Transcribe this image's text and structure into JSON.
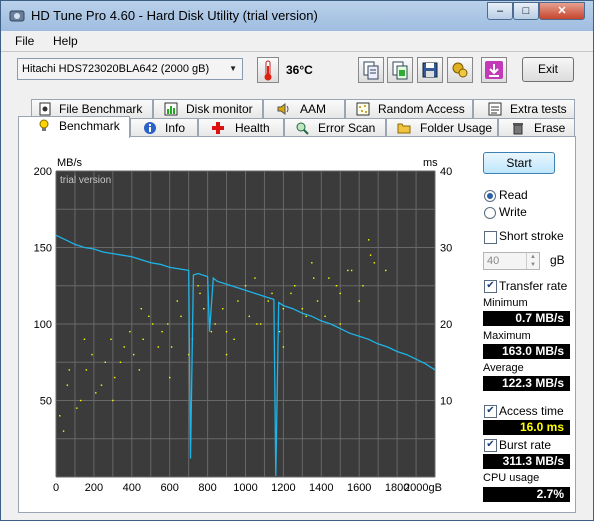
{
  "window": {
    "title": "HD Tune Pro 4.60 - Hard Disk Utility (trial version)",
    "minimize": "–",
    "maximize": "□",
    "close": "✕"
  },
  "menu": {
    "file": "File",
    "help": "Help"
  },
  "toolbar": {
    "drive": "Hitachi HDS723020BLA642 (2000 gB)",
    "temperature": "36°C",
    "exit_label": "Exit",
    "icons": [
      "thermometer-icon",
      "copy-text-icon",
      "copy-screenshot-icon",
      "save-icon",
      "options-icon",
      "download-icon"
    ]
  },
  "tabs_row1": [
    {
      "label": "File Benchmark",
      "icon": "file-benchmark-icon"
    },
    {
      "label": "Disk monitor",
      "icon": "disk-monitor-icon"
    },
    {
      "label": "AAM",
      "icon": "speaker-icon"
    },
    {
      "label": "Random Access",
      "icon": "random-access-icon"
    },
    {
      "label": "Extra tests",
      "icon": "extra-tests-icon"
    }
  ],
  "tabs_row2": [
    {
      "label": "Benchmark",
      "icon": "bulb-icon",
      "active": true
    },
    {
      "label": "Info",
      "icon": "info-icon"
    },
    {
      "label": "Health",
      "icon": "red-cross-icon"
    },
    {
      "label": "Error Scan",
      "icon": "magnifier-icon"
    },
    {
      "label": "Folder Usage",
      "icon": "folder-icon"
    },
    {
      "label": "Erase",
      "icon": "trash-icon"
    }
  ],
  "controls": {
    "start_label": "Start",
    "read_label": "Read",
    "read_checked": true,
    "write_label": "Write",
    "write_checked": false,
    "short_stroke_label": "Short stroke",
    "short_stroke_checked": false,
    "short_stroke_value": "40",
    "short_stroke_unit": "gB",
    "transfer_rate_label": "Transfer rate",
    "transfer_rate_checked": true,
    "minimum_label": "Minimum",
    "minimum_value": "0.7 MB/s",
    "maximum_label": "Maximum",
    "maximum_value": "163.0 MB/s",
    "average_label": "Average",
    "average_value": "122.3 MB/s",
    "access_time_label": "Access time",
    "access_time_checked": true,
    "access_time_value": "16.0 ms",
    "burst_rate_label": "Burst rate",
    "burst_rate_checked": true,
    "burst_rate_value": "311.3 MB/s",
    "cpu_usage_label": "CPU usage",
    "cpu_usage_value": "2.7%"
  },
  "chart_data": {
    "type": "line",
    "watermark": "trial version",
    "ylabel": "MB/s",
    "y2label": "ms",
    "xlim": [
      0,
      2000
    ],
    "ylim": [
      0,
      200
    ],
    "y2lim": [
      0,
      40
    ],
    "x_ticks": [
      "0",
      "200",
      "400",
      "600",
      "800",
      "1000",
      "1200",
      "1400",
      "1600",
      "1800",
      "2000gB"
    ],
    "y_ticks": [
      "200",
      "150",
      "100",
      "50"
    ],
    "y2_ticks": [
      "40",
      "30",
      "20",
      "10"
    ],
    "grid": true,
    "colors": {
      "background": "#3b3b3b",
      "grid": "#686868",
      "transfer": "#1eb4e8",
      "access": "#ffff00"
    },
    "series": [
      {
        "name": "Transfer rate",
        "x": [
          0,
          50,
          100,
          150,
          200,
          250,
          300,
          350,
          400,
          450,
          500,
          550,
          600,
          650,
          700,
          710,
          725,
          750,
          800,
          810,
          830,
          850,
          900,
          950,
          1000,
          1050,
          1100,
          1150,
          1160,
          1175,
          1200,
          1250,
          1300,
          1350,
          1400,
          1450,
          1500,
          1550,
          1600,
          1650,
          1700,
          1750,
          1800,
          1850,
          1900,
          1950,
          2000
        ],
        "y": [
          158,
          155,
          152,
          150,
          149,
          147,
          146,
          145,
          144,
          142,
          140,
          139,
          137,
          136,
          135,
          12,
          132,
          133,
          131,
          95,
          130,
          128,
          126,
          124,
          122,
          120,
          118,
          116,
          0.7,
          114,
          112,
          110,
          107,
          105,
          102,
          100,
          97,
          94,
          92,
          90,
          87,
          85,
          82,
          80,
          77,
          74,
          70
        ]
      },
      {
        "name": "Access time",
        "x": [
          20,
          60,
          110,
          160,
          210,
          260,
          310,
          360,
          410,
          460,
          510,
          560,
          610,
          660,
          720,
          780,
          840,
          900,
          960,
          1020,
          1080,
          1140,
          1200,
          1260,
          1320,
          1380,
          1440,
          1500,
          1560,
          1620,
          1680,
          1740,
          70,
          130,
          190,
          240,
          290,
          340,
          390,
          440,
          490,
          540,
          590,
          640,
          700,
          760,
          820,
          880,
          940,
          1000,
          1060,
          1120,
          1180,
          1240,
          1300,
          1360,
          1420,
          1480,
          1540,
          1600,
          1660,
          40,
          150,
          300,
          450,
          600,
          750,
          900,
          1050,
          1200,
          1350,
          1500,
          1650
        ],
        "y": [
          8,
          12,
          9,
          14,
          11,
          15,
          13,
          17,
          16,
          18,
          20,
          19,
          17,
          21,
          18,
          22,
          20,
          19,
          23,
          21,
          20,
          24,
          22,
          25,
          21,
          23,
          26,
          24,
          27,
          25,
          28,
          27,
          14,
          10,
          16,
          12,
          18,
          15,
          19,
          14,
          21,
          17,
          20,
          23,
          16,
          24,
          19,
          22,
          18,
          25,
          20,
          23,
          19,
          24,
          22,
          26,
          21,
          25,
          27,
          23,
          29,
          6,
          18,
          10,
          22,
          13,
          25,
          16,
          26,
          17,
          28,
          20,
          31
        ]
      }
    ]
  }
}
